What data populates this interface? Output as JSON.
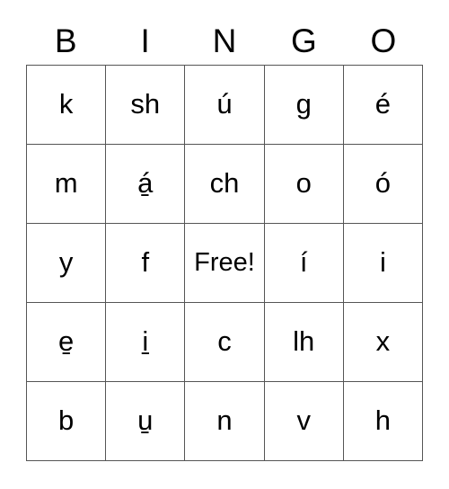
{
  "card": {
    "title": "BINGO",
    "headers": [
      "B",
      "I",
      "N",
      "G",
      "O"
    ],
    "free_label": "Free!",
    "grid_colors": {
      "border": "#555555",
      "cell_background": "#ffffff",
      "text": "#000000",
      "page_background": "#ffffff"
    },
    "rows": [
      {
        "cells": [
          "k",
          "sh",
          "ú",
          "g",
          "é"
        ]
      },
      {
        "cells": [
          "m",
          "á̱",
          "ch",
          "o",
          "ó"
        ]
      },
      {
        "cells": [
          "y",
          "f",
          "Free!",
          "í",
          "i"
        ]
      },
      {
        "cells": [
          "e̱",
          "i̱",
          "c",
          "lh",
          "x"
        ]
      },
      {
        "cells": [
          "b",
          "u̱",
          "n",
          "v",
          "h"
        ]
      }
    ]
  }
}
